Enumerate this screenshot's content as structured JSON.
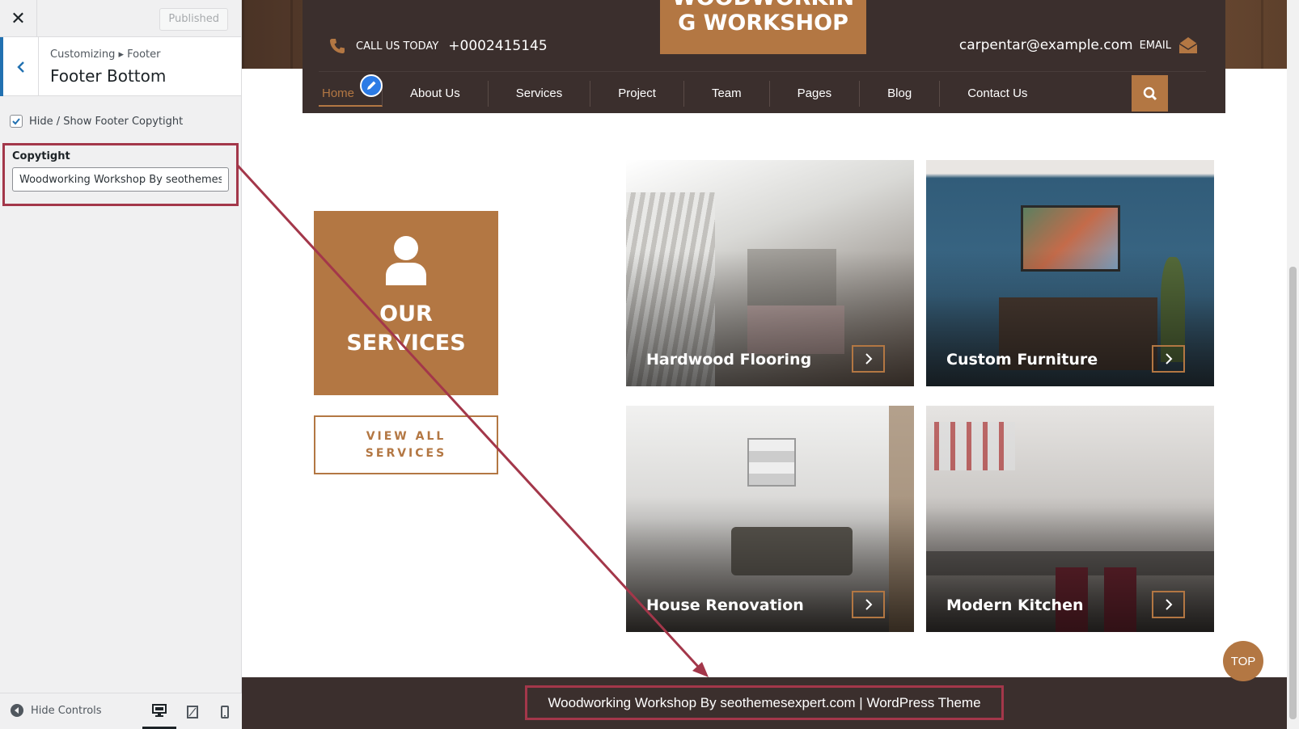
{
  "sidebar": {
    "close_icon": "close-icon",
    "published_label": "Published",
    "breadcrumb": "Customizing ▸ Footer",
    "section_title": "Footer Bottom",
    "toggle_label": "Hide / Show Footer Copytight",
    "toggle_checked": true,
    "copyright_label": "Copytight",
    "copyright_value": "Woodworking Workshop By seothemesexpert.com",
    "hide_controls_label": "Hide Controls",
    "devices": [
      "desktop-icon",
      "tablet-icon",
      "mobile-icon"
    ],
    "active_device": "desktop"
  },
  "header": {
    "logo_line1": "WOODWORKIN",
    "logo_line2": "G WORKSHOP",
    "call_label": "CALL US TODAY",
    "call_number": "+0002415145",
    "email_address": "carpentar@example.com",
    "email_label": "EMAIL",
    "nav": [
      "Home",
      "About Us",
      "Services",
      "Project",
      "Team",
      "Pages",
      "Blog",
      "Contact Us"
    ],
    "active_nav": "Home"
  },
  "services": {
    "box_title_line1": "OUR",
    "box_title_line2": "SERVICES",
    "view_all_line1": "VIEW ALL",
    "view_all_line2": "SERVICES",
    "cards": [
      {
        "title": "Hardwood Flooring"
      },
      {
        "title": "Custom Furniture"
      },
      {
        "title": "House Renovation"
      },
      {
        "title": "Modern Kitchen"
      }
    ]
  },
  "footer": {
    "copyright_text": "Woodworking Workshop By seothemesexpert.com | WordPress Theme"
  },
  "top_button_label": "TOP",
  "colors": {
    "accent": "#b37743",
    "header_bg": "#3b2f2d",
    "annotation": "#a3374a",
    "wp_blue": "#2271b1"
  }
}
